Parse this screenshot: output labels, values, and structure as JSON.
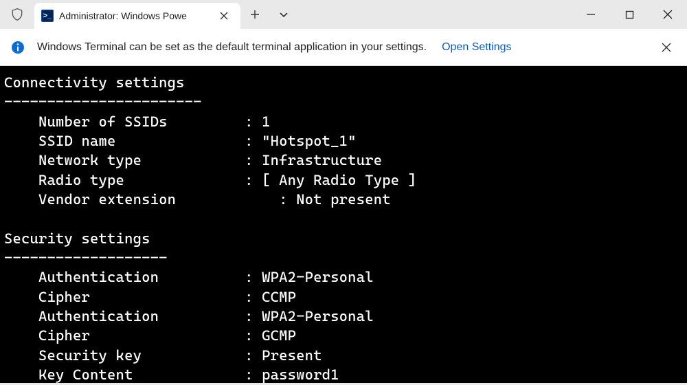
{
  "window": {
    "tab_title": "Administrator: Windows Powe",
    "icon": "powershell-icon"
  },
  "infobar": {
    "message": "Windows Terminal can be set as the default terminal application in your settings.",
    "link": "Open Settings"
  },
  "terminal": {
    "sections": {
      "connectivity": {
        "title": "Connectivity settings",
        "divider": "-----------------------",
        "rows": [
          {
            "label": "Number of SSIDs",
            "value": "1"
          },
          {
            "label": "SSID name",
            "value": "\"Hotspot_1\""
          },
          {
            "label": "Network type",
            "value": "Infrastructure"
          },
          {
            "label": "Radio type",
            "value": "[ Any Radio Type ]"
          },
          {
            "label": "Vendor extension",
            "value": "Not present",
            "indent_value": true
          }
        ]
      },
      "security": {
        "title": "Security settings",
        "divider": "-------------------",
        "rows": [
          {
            "label": "Authentication",
            "value": "WPA2-Personal"
          },
          {
            "label": "Cipher",
            "value": "CCMP"
          },
          {
            "label": "Authentication",
            "value": "WPA2-Personal"
          },
          {
            "label": "Cipher",
            "value": "GCMP"
          },
          {
            "label": "Security key",
            "value": "Present"
          },
          {
            "label": "Key Content",
            "value": "password1"
          }
        ]
      }
    }
  }
}
